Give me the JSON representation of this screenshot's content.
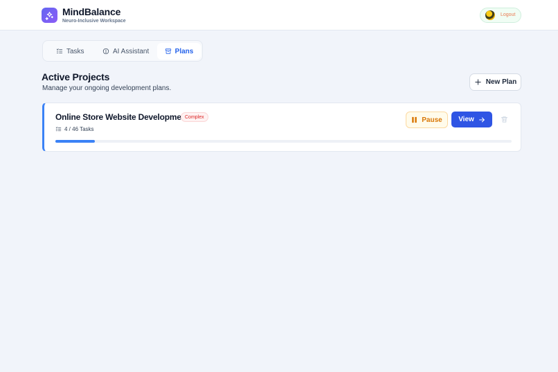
{
  "app": {
    "title": "MindBalance",
    "subtitle": "Neuro-Inclusive Workspace",
    "logout_label": "Logout"
  },
  "tabs": [
    {
      "label": "Tasks",
      "icon": "list-check-icon",
      "active": false
    },
    {
      "label": "AI Assistant",
      "icon": "robot-icon",
      "active": false
    },
    {
      "label": "Plans",
      "icon": "archive-icon",
      "active": true
    }
  ],
  "section": {
    "title": "Active Projects",
    "subtitle": "Manage your ongoing development plans.",
    "new_plan_label": "New Plan"
  },
  "projects": [
    {
      "title": "Online Store Website Development",
      "badge": "Complex",
      "tasks_done": 4,
      "tasks_total": 46,
      "tasks_text": "4 / 46 Tasks",
      "progress_fraction": 0.087,
      "pause_label": "Pause",
      "view_label": "View"
    }
  ],
  "colors": {
    "accent": "#2f55e4",
    "progress": "#3b82f6",
    "pause": "#d97706",
    "badge": "#dc2626"
  }
}
